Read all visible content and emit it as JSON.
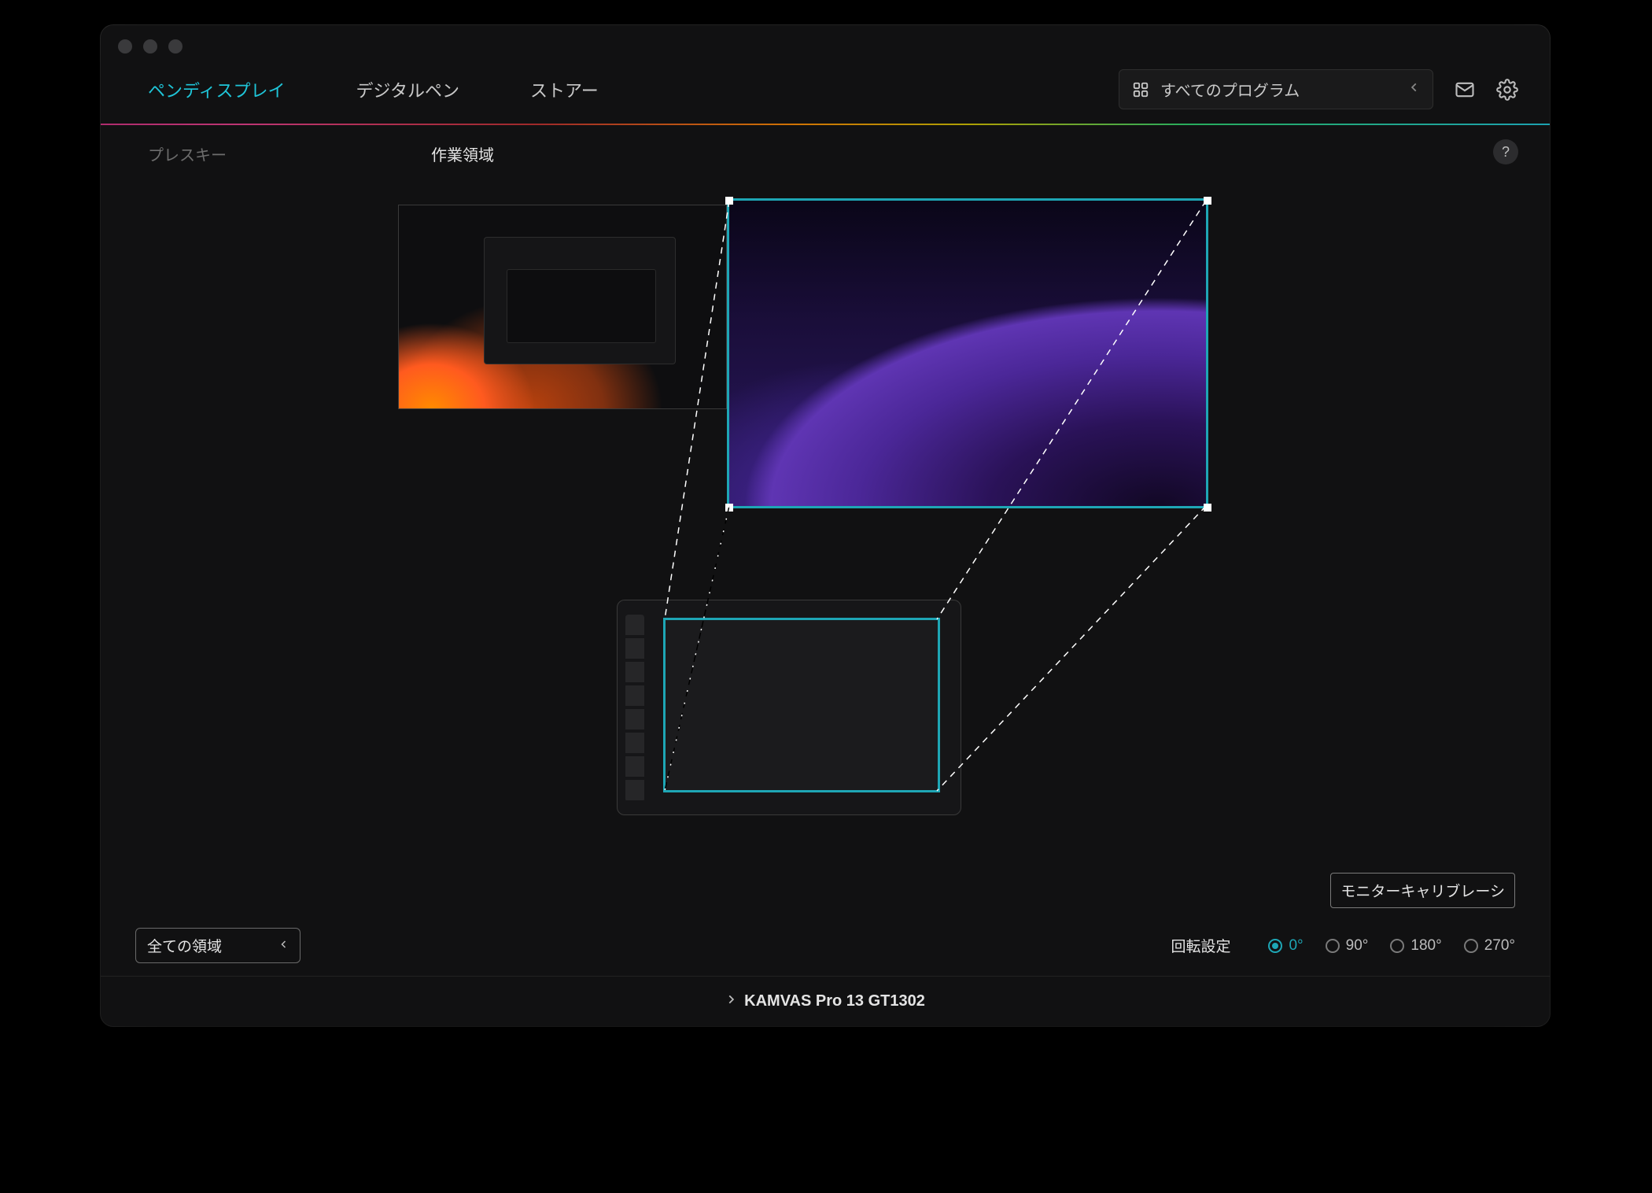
{
  "topnav": {
    "tabs": [
      {
        "label": "ペンディスプレイ",
        "active": true
      },
      {
        "label": "デジタルペン",
        "active": false
      },
      {
        "label": "ストアー",
        "active": false
      }
    ],
    "program_selector": "すべてのプログラム"
  },
  "subnav": {
    "tabs": [
      {
        "label": "プレスキー",
        "active": false
      },
      {
        "label": "作業領域",
        "active": true
      }
    ],
    "help": "?"
  },
  "calibration_button": "モニターキャリブレーシ",
  "area_selector": "全ての領域",
  "rotation": {
    "label": "回転設定",
    "options": [
      "0°",
      "90°",
      "180°",
      "270°"
    ],
    "selected": "0°"
  },
  "device": "KAMVAS Pro 13 GT1302",
  "colors": {
    "accent": "#1ea6b5"
  }
}
